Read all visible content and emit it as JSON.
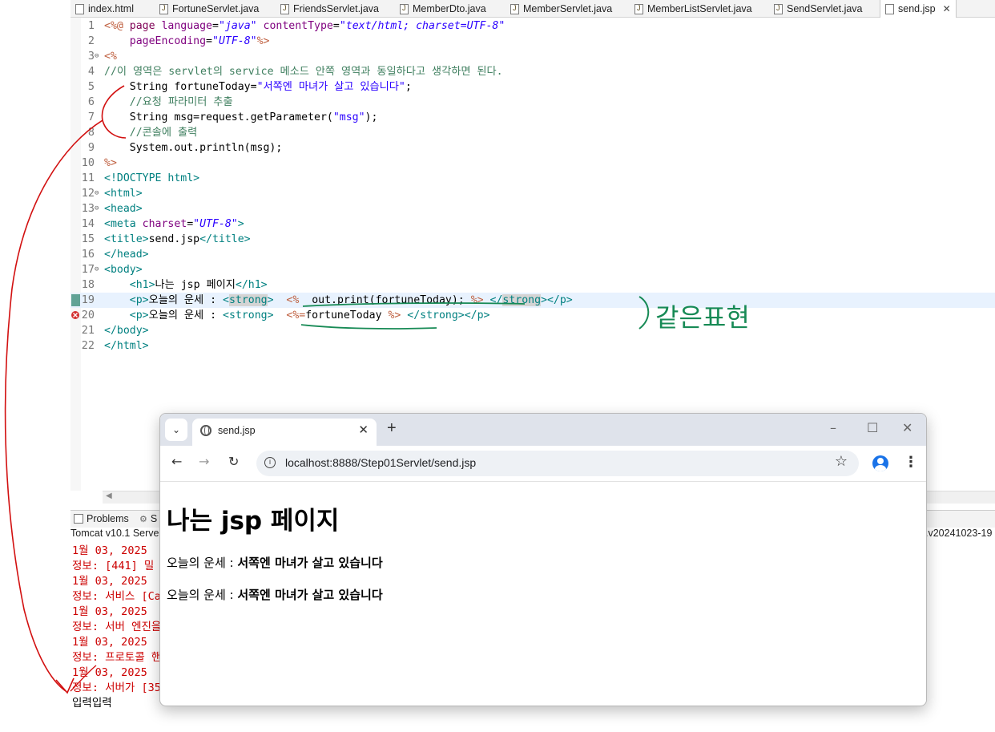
{
  "editor_tabs": [
    {
      "label": "index.html"
    },
    {
      "label": "FortuneServlet.java"
    },
    {
      "label": "FriendsServlet.java"
    },
    {
      "label": "MemberDto.java"
    },
    {
      "label": "MemberServlet.java"
    },
    {
      "label": "MemberListServlet.java"
    },
    {
      "label": "SendServlet.java"
    },
    {
      "label": "send.jsp"
    }
  ],
  "code_lines": [
    {
      "num": "1"
    },
    {
      "num": "2"
    },
    {
      "num": "3"
    },
    {
      "num": "4"
    },
    {
      "num": "5"
    },
    {
      "num": "6"
    },
    {
      "num": "7"
    },
    {
      "num": "8"
    },
    {
      "num": "9"
    },
    {
      "num": "10"
    },
    {
      "num": "11"
    },
    {
      "num": "12"
    },
    {
      "num": "13"
    },
    {
      "num": "14"
    },
    {
      "num": "15"
    },
    {
      "num": "16"
    },
    {
      "num": "17"
    },
    {
      "num": "18"
    },
    {
      "num": "19"
    },
    {
      "num": "20"
    },
    {
      "num": "21"
    },
    {
      "num": "22"
    }
  ],
  "code": {
    "l1_a": "<%@ ",
    "l1_b": "page ",
    "l1_c": "language",
    "l1_d": "=",
    "l1_e": "\"java\"",
    "l1_f": " contentType",
    "l1_g": "=",
    "l1_h": "\"text/html; charset=UTF-8\"",
    "l2_a": "    pageEncoding",
    "l2_b": "=",
    "l2_c": "\"UTF-8\"",
    "l2_d": "%>",
    "l3": "<%",
    "l4": "//이 영역은 servlet의 service 메소드 안쪽 영역과 동일하다고 생각하면 된다.",
    "l5_a": "    String fortuneToday=",
    "l5_b": "\"서쪽엔 마녀가 살고 있습니다\"",
    "l5_c": ";",
    "l6": "    //요청 파라미터 추출",
    "l7_a": "    String msg=request.getParameter(",
    "l7_b": "\"msg\"",
    "l7_c": ");",
    "l8": "    //콘솔에 출력",
    "l9": "    System.out.println(msg);",
    "l10": "%>",
    "l11": "<!DOCTYPE html>",
    "l12": "<html>",
    "l13": "<head>",
    "l14_a": "<meta ",
    "l14_b": "charset",
    "l14_c": "=",
    "l14_d": "\"UTF-8\"",
    "l14_e": ">",
    "l15_a": "<title>",
    "l15_b": "send.jsp",
    "l15_c": "</title>",
    "l16": "</head>",
    "l17": "<body>",
    "l18_a": "    <h1>",
    "l18_b": "나는 jsp 페이지",
    "l18_c": "</h1>",
    "l19_a": "    <p>",
    "l19_b": "오늘의 운세 : ",
    "l19_c": "<",
    "l19_d": "strong",
    "l19_e": ">  ",
    "l19_f": "<%",
    "l19_g": "  out.print(fortuneToday); ",
    "l19_h": "%>",
    "l19_i": " </",
    "l19_j": "strong",
    "l19_k": "></p>",
    "l20_a": "    <p>",
    "l20_b": "오늘의 운세 : ",
    "l20_c": "<strong>  ",
    "l20_d": "<%=",
    "l20_e": "fortuneToday ",
    "l20_f": "%>",
    "l20_g": " </strong></p>",
    "l21": "</body>",
    "l22": "</html>"
  },
  "annotation": {
    "text": "같은표현"
  },
  "console": {
    "tab_problems": "Problems",
    "tab_servers": "S",
    "server_label": "Tomcat v10.1 Server",
    "server_suffix": ".v20241023-19",
    "lines": [
      "1월 03, 2025",
      "정보: [441] 밀",
      "1월 03, 2025",
      "정보: 서비스 [Ca",
      "1월 03, 2025",
      "정보: 서버 엔진을",
      "1월 03, 2025",
      "정보: 프로토콜 핸",
      "1월 03, 2025",
      "정보: 서버가 [35"
    ],
    "last_line": "입력입력"
  },
  "browser": {
    "tab_title": "send.jsp",
    "url": "localhost:8888/Step01Servlet/send.jsp",
    "page": {
      "heading": "나는 jsp 페이지",
      "p1_label": "오늘의 운세 : ",
      "p1_value": "서쪽엔 마녀가 살고 있습니다",
      "p2_label": "오늘의 운세 : ",
      "p2_value": "서쪽엔 마녀가 살고 있습니다"
    }
  },
  "colors": {
    "annotation_green": "#178a55",
    "annotation_red": "#d21010",
    "console_red": "#cc0000"
  }
}
